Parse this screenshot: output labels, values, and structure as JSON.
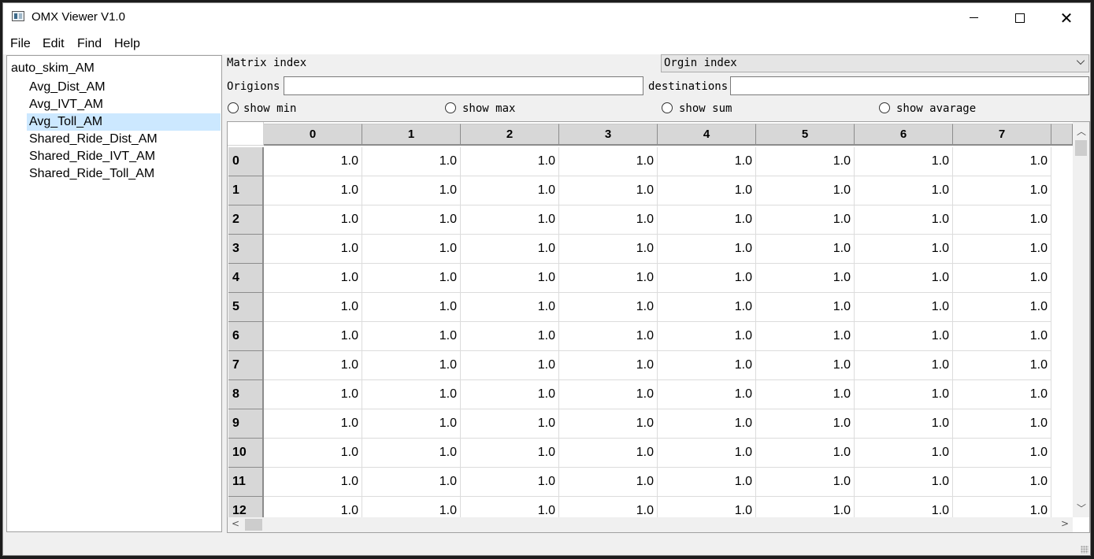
{
  "window": {
    "title": "OMX Viewer V1.0"
  },
  "menu": [
    "File",
    "Edit",
    "Find",
    "Help"
  ],
  "tree": {
    "root": "auto_skim_AM",
    "children": [
      "Avg_Dist_AM",
      "Avg_IVT_AM",
      "Avg_Toll_AM",
      "Shared_Ride_Dist_AM",
      "Shared_Ride_IVT_AM",
      "Shared_Ride_Toll_AM"
    ],
    "selected_index": 2
  },
  "controls": {
    "matrix_index_label": "Matrix index",
    "index_select_value": "Orgin index",
    "origins_label": "Origions",
    "origins_value": "",
    "destinations_label": "destinations",
    "destinations_value": "",
    "radios": [
      "show min",
      "show max",
      "show sum",
      "show avarage"
    ]
  },
  "table": {
    "columns": [
      "0",
      "1",
      "2",
      "3",
      "4",
      "5",
      "6",
      "7"
    ],
    "rows": [
      "0",
      "1",
      "2",
      "3",
      "4",
      "5",
      "6",
      "7",
      "8",
      "9",
      "10",
      "11",
      "12"
    ],
    "cells": [
      [
        "1.0",
        "1.0",
        "1.0",
        "1.0",
        "1.0",
        "1.0",
        "1.0",
        "1.0"
      ],
      [
        "1.0",
        "1.0",
        "1.0",
        "1.0",
        "1.0",
        "1.0",
        "1.0",
        "1.0"
      ],
      [
        "1.0",
        "1.0",
        "1.0",
        "1.0",
        "1.0",
        "1.0",
        "1.0",
        "1.0"
      ],
      [
        "1.0",
        "1.0",
        "1.0",
        "1.0",
        "1.0",
        "1.0",
        "1.0",
        "1.0"
      ],
      [
        "1.0",
        "1.0",
        "1.0",
        "1.0",
        "1.0",
        "1.0",
        "1.0",
        "1.0"
      ],
      [
        "1.0",
        "1.0",
        "1.0",
        "1.0",
        "1.0",
        "1.0",
        "1.0",
        "1.0"
      ],
      [
        "1.0",
        "1.0",
        "1.0",
        "1.0",
        "1.0",
        "1.0",
        "1.0",
        "1.0"
      ],
      [
        "1.0",
        "1.0",
        "1.0",
        "1.0",
        "1.0",
        "1.0",
        "1.0",
        "1.0"
      ],
      [
        "1.0",
        "1.0",
        "1.0",
        "1.0",
        "1.0",
        "1.0",
        "1.0",
        "1.0"
      ],
      [
        "1.0",
        "1.0",
        "1.0",
        "1.0",
        "1.0",
        "1.0",
        "1.0",
        "1.0"
      ],
      [
        "1.0",
        "1.0",
        "1.0",
        "1.0",
        "1.0",
        "1.0",
        "1.0",
        "1.0"
      ],
      [
        "1.0",
        "1.0",
        "1.0",
        "1.0",
        "1.0",
        "1.0",
        "1.0",
        "1.0"
      ],
      [
        "1.0",
        "1.0",
        "1.0",
        "1.0",
        "1.0",
        "1.0",
        "1.0",
        "1.0"
      ]
    ]
  },
  "colors": {
    "selection": "#cce8ff",
    "header_bg": "#d7d7d7"
  }
}
